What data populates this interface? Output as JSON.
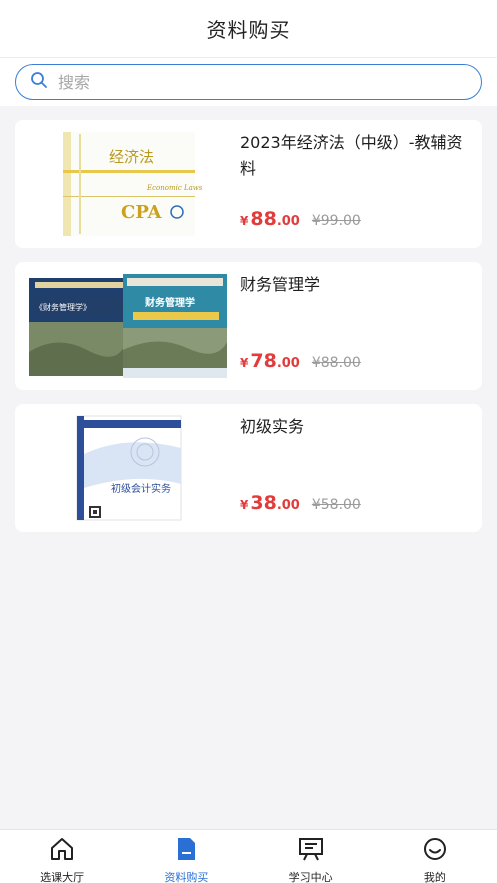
{
  "header": {
    "title": "资料购买"
  },
  "search": {
    "placeholder": "搜索",
    "value": ""
  },
  "products": [
    {
      "title": "2023年经济法（中级）-教辅资料",
      "price_symbol": "¥",
      "price_int": "88",
      "price_dec": ".00",
      "original_price": "¥99.00",
      "cover": {
        "title": "经济法",
        "subtitle": "Economic Laws",
        "brand": "CPA"
      }
    },
    {
      "title": "财务管理学",
      "price_symbol": "¥",
      "price_int": "78",
      "price_dec": ".00",
      "original_price": "¥88.00",
      "cover": {
        "title_left": "《财务管理学》",
        "title_right": "财务管理学"
      }
    },
    {
      "title": "初级实务",
      "price_symbol": "¥",
      "price_int": "38",
      "price_dec": ".00",
      "original_price": "¥58.00",
      "cover": {
        "title": "初级会计实务"
      }
    }
  ],
  "tabbar": {
    "items": [
      {
        "label": "选课大厅",
        "icon": "home-icon",
        "active": false
      },
      {
        "label": "资料购买",
        "icon": "document-icon",
        "active": true
      },
      {
        "label": "学习中心",
        "icon": "presentation-icon",
        "active": false
      },
      {
        "label": "我的",
        "icon": "smile-icon",
        "active": false
      }
    ]
  },
  "colors": {
    "accent": "#2a6fd6",
    "price": "#e23b3b",
    "search_border": "#3a7fd5"
  }
}
